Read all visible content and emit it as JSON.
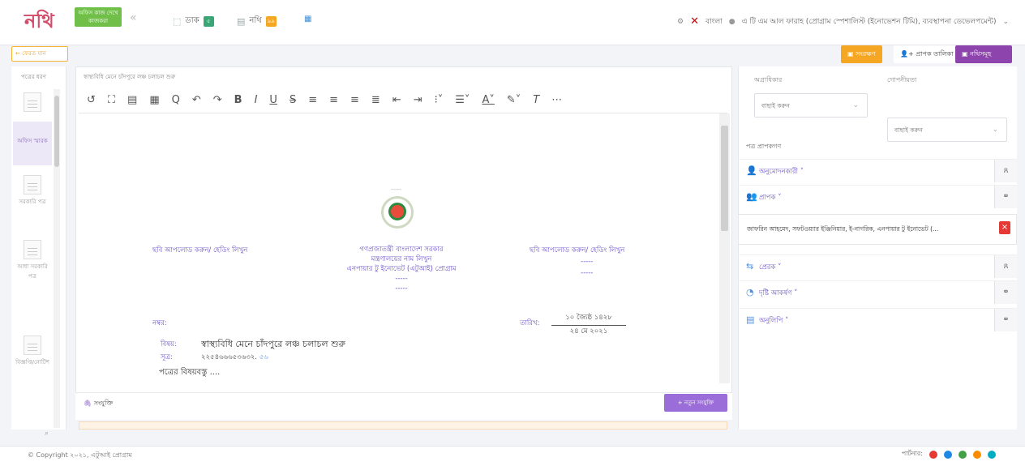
{
  "header": {
    "logo_text": "নথি",
    "logo_badge": "অফিস কাজ দেখে কাজকরা",
    "collapse_icon": "double-chevron-left",
    "nav": [
      {
        "label": "ডাক",
        "count": "৫",
        "color": "#3aa675"
      },
      {
        "label": "নথি",
        "count": "৯৯",
        "color": "#f5a623"
      }
    ],
    "lang_label": "বাংলা",
    "user_text": "এ টি এম আল ফারাহ (প্রোগ্রাম স্পেশালিস্ট (ইনোভেশন টিমি), ব্যবস্থাপনা ডেভেলপমেন্ট)"
  },
  "actions": {
    "back_label": "ফেরত যান",
    "save_label": "সংরক্ষণ",
    "address_label": "প্রাপক তালিকা",
    "note_label": "নথিসমূহ"
  },
  "left_panel": {
    "title": "পত্রের ধরণ",
    "items": [
      {
        "label": "",
        "active": false
      },
      {
        "label": "অফিস স্মারক",
        "active": true
      },
      {
        "label": "সরকারি পত্র",
        "active": false
      },
      {
        "label": "আধা সরকারি পত্র",
        "active": false
      },
      {
        "label": "বিজ্ঞপ্তি/নোটিশ",
        "active": false
      }
    ]
  },
  "editor": {
    "subject_line": "স্বাস্থ্যবিধি মেনে চাঁদপুরে লঞ্চ চলাচল শুরু",
    "document": {
      "left_header": "ছবি আপলোড করুন/ হেডিং লিখুন",
      "center_line1": "গণপ্রজাতন্ত্রী বাংলাদেশ সরকার",
      "center_line2": "মন্ত্রণালয়ের নাম লিখুন",
      "center_line3": "এনপায়ার টু ইনোভেট (এটুআই) প্রোগ্রাম",
      "center_line4": "-----",
      "center_line5": "-----",
      "right_header": "ছবি আপলোড করুন/ হেডিং লিখুন",
      "right_line1": "-----",
      "right_line2": "-----",
      "memo_label": "নম্বর:",
      "date_label": "তারিখ:",
      "date_bn": "১০ জ্যৈষ্ঠ ১৪২৮",
      "date_en": "২৪ মে ২০২১",
      "subject_label": "বিষয়:",
      "subject_text": "স্বাস্থ্যবিধি মেনে চাঁদপুরে লঞ্চ চলাচল শুরু",
      "ref_label": "সূত্র:",
      "ref_text": "২২৫৪৬৬৬৫৩৬৩২.",
      "ref_link": "৫৬",
      "body_start": "পত্রের বিষয়বস্তু ...."
    },
    "attach_label": "সংযুক্তি",
    "new_attach_label": "+ নতুন সংযুক্তি"
  },
  "right_panel": {
    "priority_label": "অগ্রাধিকার",
    "priority_value": "বাছাই করুন",
    "secrecy_label": "গোপনীয়তা",
    "secrecy_value": "বাছাই করুন",
    "recipients_title": "পত্র প্রাপকগণ",
    "rows": [
      {
        "label": "অনুমোদনকারী ˅"
      },
      {
        "label": "প্রাপক ˅"
      },
      {
        "label": "প্রেরক ˅"
      },
      {
        "label": "দৃষ্টি আকর্ষণ ˅"
      },
      {
        "label": "অনুলিপি ˅"
      }
    ],
    "recipient_chip": "জাফরিন আহমেদ, সফটওয়্যার ইঞ্জিনিয়ার, ই-নাগরিক, এনপায়ার টু ইনোভেট (..."
  },
  "footer": {
    "copyright": "© Copyright ২০২১, এটুআই প্রোগ্রাম",
    "partner_label": "পার্টনার:"
  }
}
